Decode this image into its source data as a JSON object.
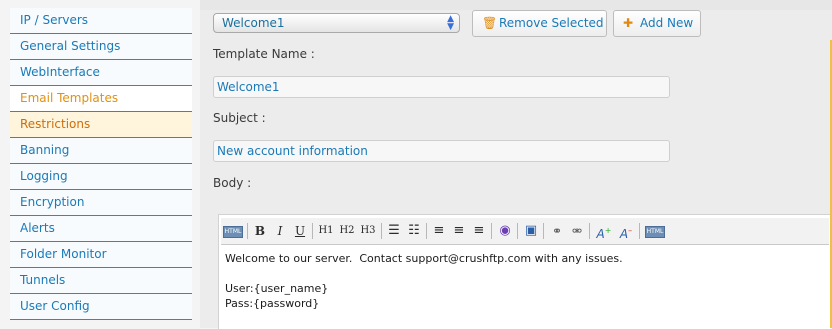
{
  "sidebar": {
    "items": [
      {
        "label": "IP / Servers"
      },
      {
        "label": "General Settings"
      },
      {
        "label": "WebInterface"
      },
      {
        "label": "Email Templates"
      },
      {
        "label": "Restrictions"
      },
      {
        "label": "Banning"
      },
      {
        "label": "Logging"
      },
      {
        "label": "Encryption"
      },
      {
        "label": "Alerts"
      },
      {
        "label": "Folder Monitor"
      },
      {
        "label": "Tunnels"
      },
      {
        "label": "User Config"
      }
    ]
  },
  "template_select": {
    "value": "Welcome1"
  },
  "buttons": {
    "remove": "Remove Selected",
    "add": "Add New"
  },
  "form": {
    "template_name_label": "Template Name :",
    "template_name_value": "Welcome1",
    "subject_label": "Subject :",
    "subject_value": "New account information",
    "body_label": "Body :"
  },
  "toolbar": {
    "html": "HTML",
    "bold": "B",
    "italic": "I",
    "underline": "U",
    "h1": "H1",
    "h2": "H2",
    "h3": "H3"
  },
  "body": {
    "line1": "Welcome to our server.  Contact support@crushftp.com with any issues.",
    "line2": "User:{user_name}",
    "line3": "Pass:{password}"
  },
  "colors": {
    "link": "#1a7ab8",
    "active": "#e0920f",
    "hover_bg": "#fff5dc"
  }
}
